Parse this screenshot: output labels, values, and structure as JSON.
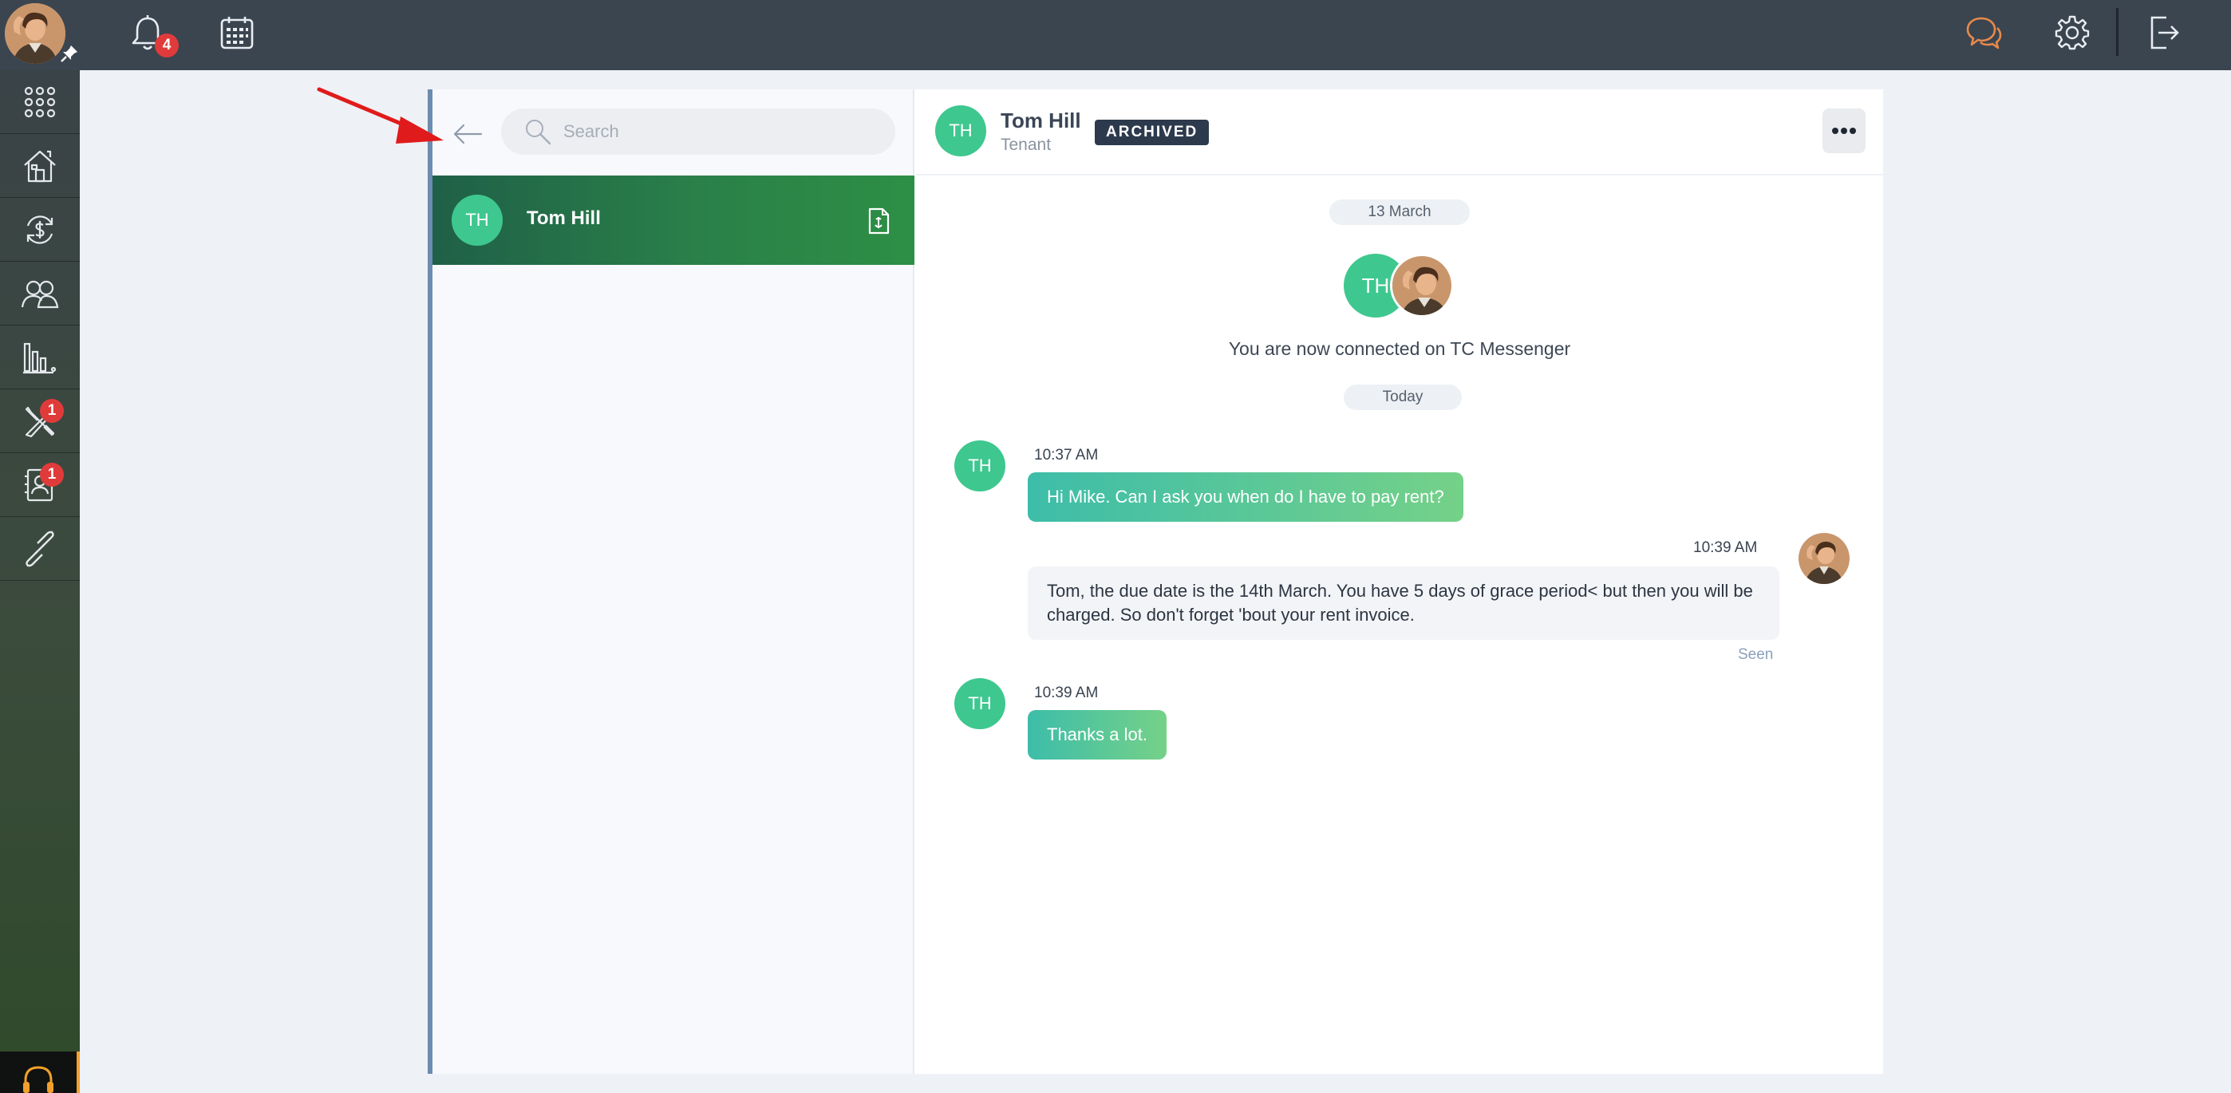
{
  "topbar": {
    "notifications": {
      "icon": "bell-icon",
      "badge": "4"
    },
    "calendar_icon": "calendar-icon",
    "chat_icon": "chat-bubbles-icon",
    "settings_icon": "gear-icon",
    "logout_icon": "logout-icon",
    "accent_color": "#e8894a"
  },
  "sidebar": {
    "items": [
      {
        "name": "apps-grid",
        "icon": "grid-icon",
        "badge": null
      },
      {
        "name": "properties",
        "icon": "house-icon",
        "badge": null
      },
      {
        "name": "finance",
        "icon": "money-cycle-icon",
        "badge": null
      },
      {
        "name": "contacts",
        "icon": "people-icon",
        "badge": null
      },
      {
        "name": "reports",
        "icon": "bar-chart-icon",
        "badge": null
      },
      {
        "name": "maintenance",
        "icon": "tools-icon",
        "badge": "1"
      },
      {
        "name": "applications",
        "icon": "contact-card-icon",
        "badge": "1"
      },
      {
        "name": "links",
        "icon": "link-icon",
        "badge": null
      }
    ],
    "support_icon": "headset-icon"
  },
  "list": {
    "search_placeholder": "Search",
    "contacts": [
      {
        "initials": "TH",
        "name": "Tom Hill",
        "doc_icon": "document-icon"
      }
    ]
  },
  "chat": {
    "header": {
      "initials": "TH",
      "name": "Tom Hill",
      "role": "Tenant",
      "status": "ARCHIVED"
    },
    "date_1": "13 March",
    "connected_initials": "TH",
    "connected_text": "You are now connected on TC Messenger",
    "date_2": "Today",
    "messages": [
      {
        "direction": "in",
        "initials": "TH",
        "time": "10:37 AM",
        "text": "Hi Mike. Can I ask you when do I have to pay rent?"
      },
      {
        "direction": "out",
        "time": "10:39 AM",
        "text": "Tom, the due date is the 14th March. You have 5 days of grace period< but then you will be charged. So don't forget 'bout your rent invoice.",
        "status": "Seen"
      },
      {
        "direction": "in",
        "initials": "TH",
        "time": "10:39 AM",
        "text": "Thanks a lot."
      }
    ]
  }
}
